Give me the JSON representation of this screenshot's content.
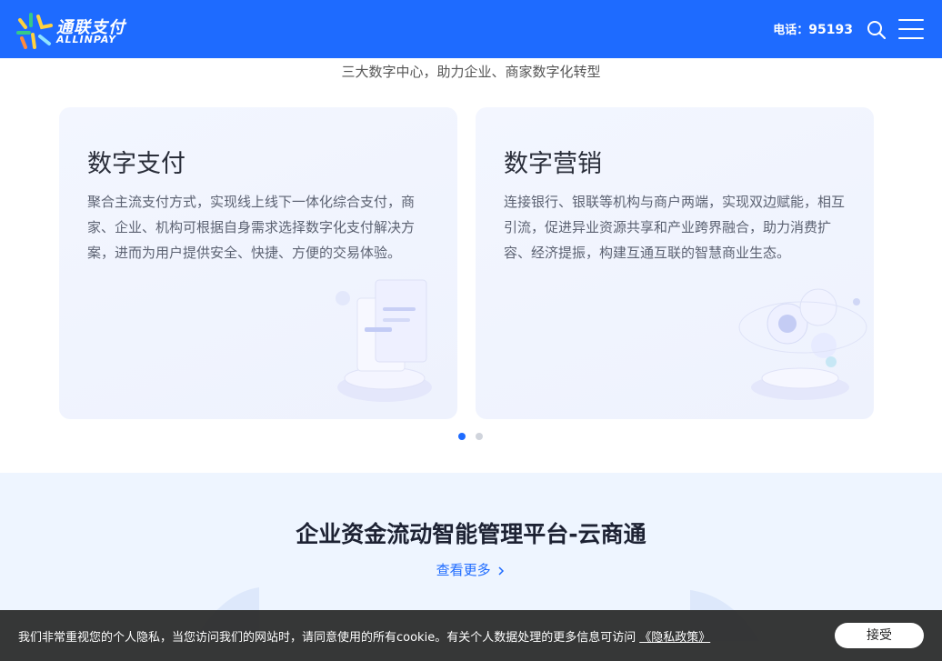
{
  "header": {
    "logo_cn": "通联支付",
    "logo_en": "ALLINPAY",
    "phone_label": "电话：",
    "phone_number": "95193",
    "bg_color": "#1e6bff"
  },
  "intro": {
    "subtitle": "三大数字中心，助力企业、商家数字化转型"
  },
  "cards": [
    {
      "title": "数字支付",
      "desc": "聚合主流支付方式，实现线上线下一体化综合支付，商家、企业、机构可根据自身需求选择数字化支付解决方案，进而为用户提供安全、快捷、方便的交易体验。",
      "icon": "payment-terminal-illustration"
    },
    {
      "title": "数字营销",
      "desc": "连接银行、银联等机构与商户两端，实现双边赋能，相互引流，促进异业资源共享和产业跨界融合，助力消费扩容、经济提振，构建互通互联的智慧商业生态。",
      "icon": "marketing-globe-illustration"
    }
  ],
  "carousel": {
    "active_index": 0,
    "count": 2,
    "active_color": "#1e6bff",
    "inactive_color": "#d0d4dc"
  },
  "section2": {
    "title": "企业资金流动智能管理平台-云商通",
    "link_text": "查看更多",
    "link_icon": "chevron-right-icon"
  },
  "cookie": {
    "text": "我们非常重视您的个人隐私，当您访问我们的网站时，请同意使用的所有cookie。有关个人数据处理的更多信息可访问",
    "link_text": "《隐私政策》",
    "accept_label": "接受"
  }
}
